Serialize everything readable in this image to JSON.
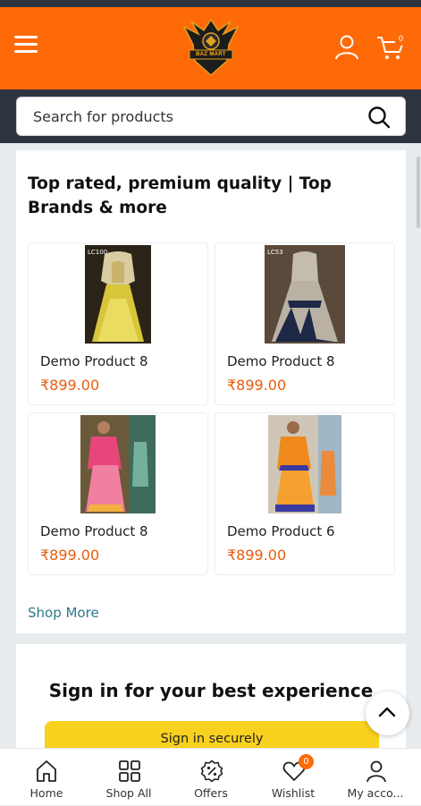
{
  "header": {
    "logo_text": "BAZ MART",
    "cart_count": "0"
  },
  "search": {
    "placeholder": "Search for products"
  },
  "section": {
    "title": "Top rated, premium quality | Top Brands & more",
    "shop_more": "Shop More"
  },
  "products": [
    {
      "name": "Demo Product 8",
      "price": "₹899.00",
      "tag": "LC100"
    },
    {
      "name": "Demo Product 8",
      "price": "₹899.00",
      "tag": "LC53"
    },
    {
      "name": "Demo Product 8",
      "price": "₹899.00",
      "tag": ""
    },
    {
      "name": "Demo Product 6",
      "price": "₹899.00",
      "tag": ""
    }
  ],
  "signin": {
    "title": "Sign in for your best experience",
    "button": "Sign in securely"
  },
  "bottom_nav": {
    "items": [
      {
        "label": "Home",
        "icon": "home-icon"
      },
      {
        "label": "Shop All",
        "icon": "grid-icon"
      },
      {
        "label": "Offers",
        "icon": "offer-badge-icon"
      },
      {
        "label": "Wishlist",
        "icon": "heart-icon"
      },
      {
        "label": "My acco...",
        "icon": "user-icon"
      }
    ],
    "wishlist_count": "0"
  },
  "colors": {
    "brand_orange": "#ff6a08",
    "dark_bar": "#2d3440",
    "price": "#e85d0c",
    "signin_button": "#f9d11f",
    "link": "#2a7a8c"
  }
}
